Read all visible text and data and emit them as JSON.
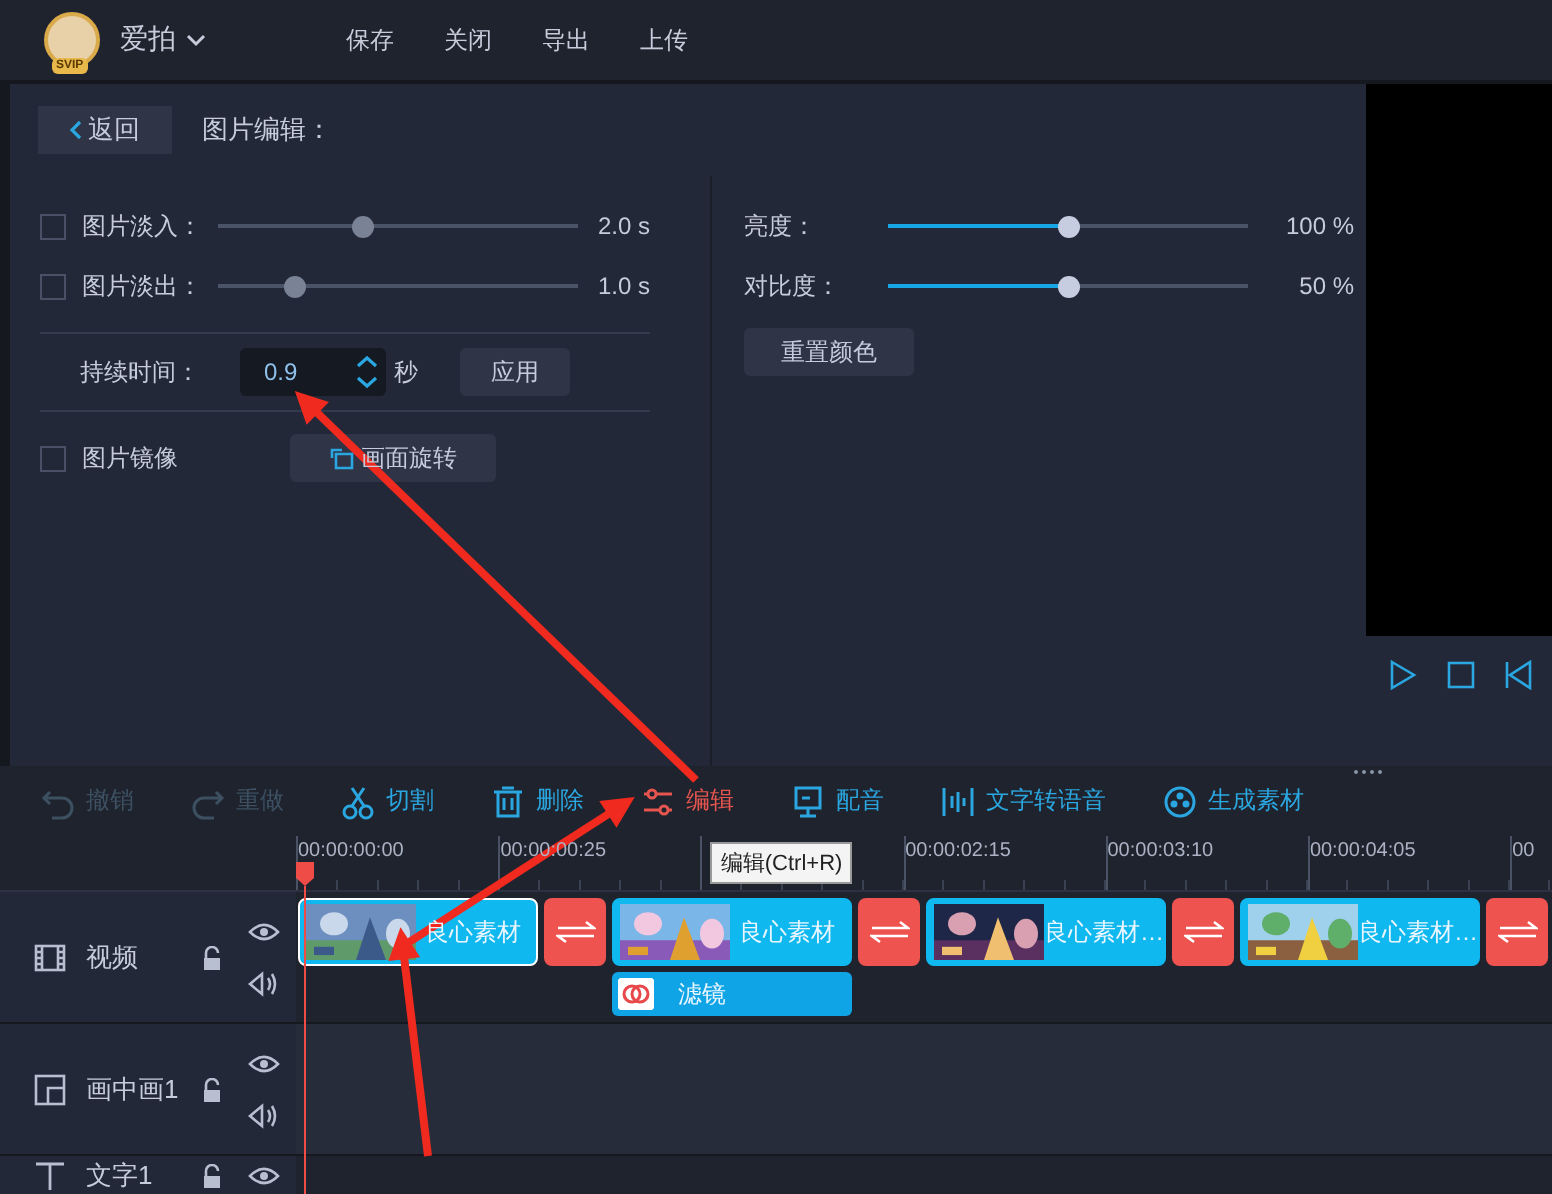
{
  "top_bar": {
    "user_name": "爱拍",
    "badge": "SVIP",
    "menu": [
      "保存",
      "关闭",
      "导出",
      "上传"
    ]
  },
  "editor": {
    "back_button": "返回",
    "title": "图片编辑：",
    "fades": [
      {
        "label": "图片淡入：",
        "checked": false,
        "disabled": true,
        "level": 0.4,
        "reading": "2.0 s"
      },
      {
        "label": "图片淡出：",
        "checked": false,
        "disabled": true,
        "level": 0.21,
        "reading": "1.0 s"
      }
    ],
    "duration": {
      "label": "持续时间：",
      "value": "0.9",
      "unit": "秒",
      "apply_button": "应用"
    },
    "mirror": {
      "label": "图片镜像",
      "checked": false
    },
    "rotate_button": "画面旋转",
    "color": [
      {
        "label": "亮度：",
        "disabled": false,
        "level": 0.5,
        "reading": "100 %"
      },
      {
        "label": "对比度：",
        "disabled": false,
        "level": 0.5,
        "reading": "50 %"
      }
    ],
    "reset_button": "重置颜色"
  },
  "toolbar": [
    {
      "kind": "undo",
      "label": "撤销",
      "disabled": true,
      "active": false
    },
    {
      "kind": "redo",
      "label": "重做",
      "disabled": true,
      "active": false
    },
    {
      "kind": "cut",
      "label": "切割",
      "disabled": false,
      "active": false
    },
    {
      "kind": "delete",
      "label": "删除",
      "disabled": false,
      "active": false
    },
    {
      "kind": "edit",
      "label": "编辑",
      "disabled": false,
      "active": true
    },
    {
      "kind": "dub",
      "label": "配音",
      "disabled": false,
      "active": false
    },
    {
      "kind": "tts",
      "label": "文字转语音",
      "disabled": false,
      "active": false
    },
    {
      "kind": "generate",
      "label": "生成素材",
      "disabled": false,
      "active": false
    }
  ],
  "ruler": [
    {
      "kind": "tick",
      "label": "00:00:00:00"
    },
    {
      "kind": "tick",
      "label": "00:00:00:25"
    },
    {
      "kind": "tooltip",
      "label": "编辑(Ctrl+R)"
    },
    {
      "kind": "tick",
      "label": "00:00:02:15"
    },
    {
      "kind": "tick",
      "label": "00:00:03:10"
    },
    {
      "kind": "tick",
      "label": "00:00:04:05"
    },
    {
      "kind": "tick",
      "label": "00"
    }
  ],
  "tracks": [
    {
      "kind": "video",
      "name": "视频",
      "clips": [
        {
          "kind": "clip",
          "label": "良心素材",
          "selected": true
        },
        {
          "kind": "transition"
        },
        {
          "kind": "clip",
          "label": "良心素材",
          "selected": false,
          "effect": {
            "label": "滤镜"
          }
        },
        {
          "kind": "transition"
        },
        {
          "kind": "clip",
          "label": "良心素材…",
          "selected": false
        },
        {
          "kind": "transition"
        },
        {
          "kind": "clip",
          "label": "良心素材…",
          "selected": false
        },
        {
          "kind": "transition"
        }
      ]
    },
    {
      "kind": "pip",
      "name": "画中画1"
    },
    {
      "kind": "text",
      "name": "文字1"
    }
  ]
}
